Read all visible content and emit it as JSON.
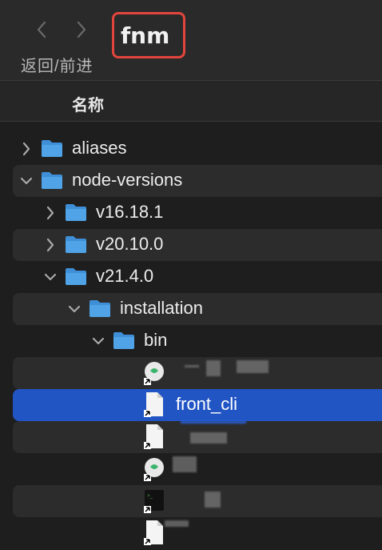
{
  "toolbar": {
    "back_icon": "chevron-left-icon",
    "forward_icon": "chevron-right-icon",
    "nav_label": "返回/前进",
    "folder_title": "fnm",
    "highlight_color": "#e2453c"
  },
  "header": {
    "name_column": "名称"
  },
  "rows": [
    {
      "label": "aliases",
      "type": "folder",
      "expanded": false
    },
    {
      "label": "node-versions",
      "type": "folder",
      "expanded": true
    },
    {
      "label": "v16.18.1",
      "type": "folder",
      "expanded": false
    },
    {
      "label": "v20.10.0",
      "type": "folder",
      "expanded": false
    },
    {
      "label": "v21.4.0",
      "type": "folder",
      "expanded": true
    },
    {
      "label": "installation",
      "type": "folder",
      "expanded": true
    },
    {
      "label": "bin",
      "type": "folder",
      "expanded": true
    },
    {
      "label": "",
      "type": "alias-app",
      "redacted": true
    },
    {
      "label": "front_cli",
      "type": "alias-doc",
      "selected": true
    },
    {
      "label": "",
      "type": "alias-doc",
      "redacted": true
    },
    {
      "label": "",
      "type": "alias-app",
      "redacted": true
    },
    {
      "label": "",
      "type": "alias-exec",
      "redacted": true
    },
    {
      "label": "",
      "type": "alias-doc",
      "redacted": true
    }
  ],
  "colors": {
    "selection": "#2255c4",
    "folder": "#4fa3e6"
  }
}
